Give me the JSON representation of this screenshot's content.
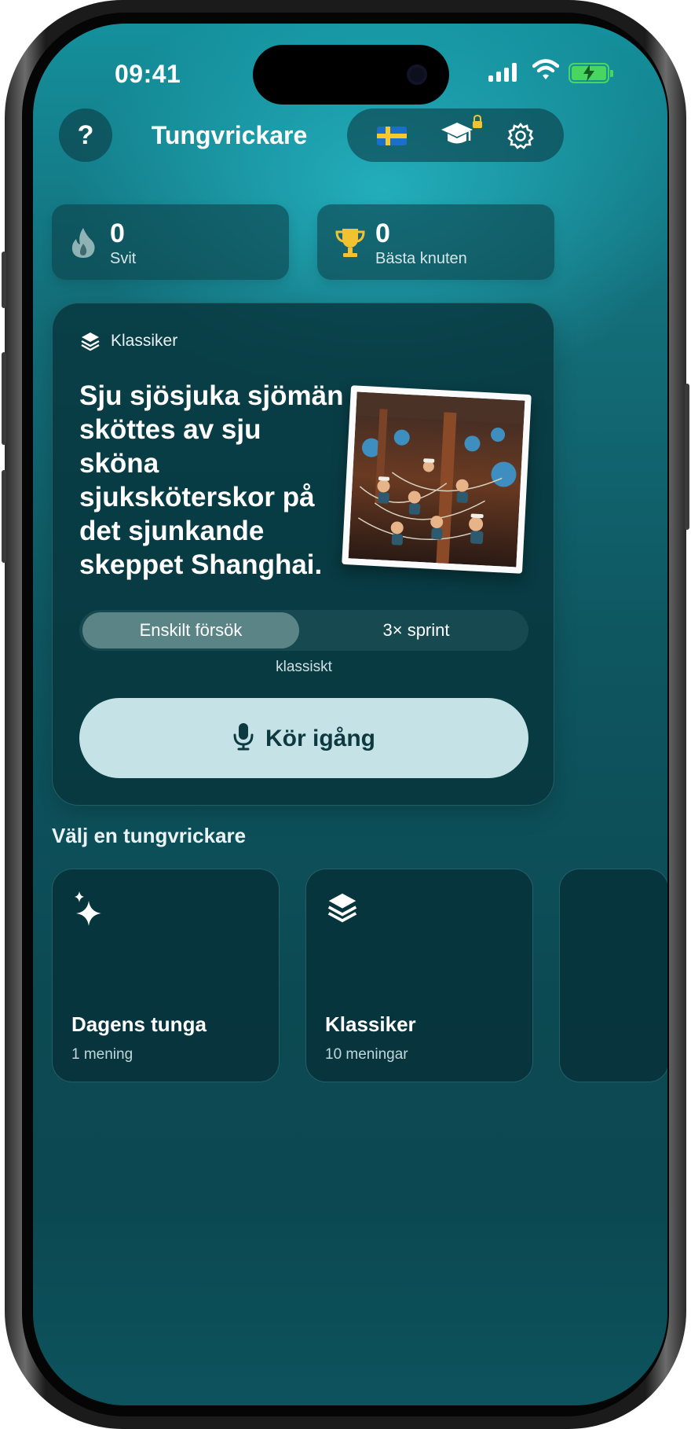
{
  "status_bar": {
    "time": "09:41",
    "battery_color": "#49d65f"
  },
  "header": {
    "help_label": "?",
    "title": "Tungvrickare",
    "language_icon": "swedish-flag-icon",
    "learn_icon": "graduation-cap-icon",
    "settings_icon": "gear-icon"
  },
  "stats": [
    {
      "icon": "flame-icon",
      "value": "0",
      "label": "Svit"
    },
    {
      "icon": "trophy-icon",
      "value": "0",
      "label": "Bästa knuten"
    }
  ],
  "featured": {
    "category": "Klassiker",
    "sentence": "Sju sjösjuka sjömän sköttes av sju sköna sjuksköterskor på det sjunkande skeppet Shanghai.",
    "modes": [
      "Enskilt försök",
      "3× sprint"
    ],
    "selected_mode": "Enskilt försök",
    "mode_caption": "klassiskt",
    "start_label": "Kör igång"
  },
  "picker": {
    "heading": "Välj en tungvrickare",
    "tiles": [
      {
        "icon": "sparkles-icon",
        "name": "Dagens tunga",
        "count": "1 mening"
      },
      {
        "icon": "layers-icon",
        "name": "Klassiker",
        "count": "10 meningar"
      }
    ]
  },
  "colors": {
    "accent_button": "#c5e3e7",
    "background_top": "#14909c",
    "background_bottom": "#0c4a53",
    "trophy": "#f2c230"
  }
}
